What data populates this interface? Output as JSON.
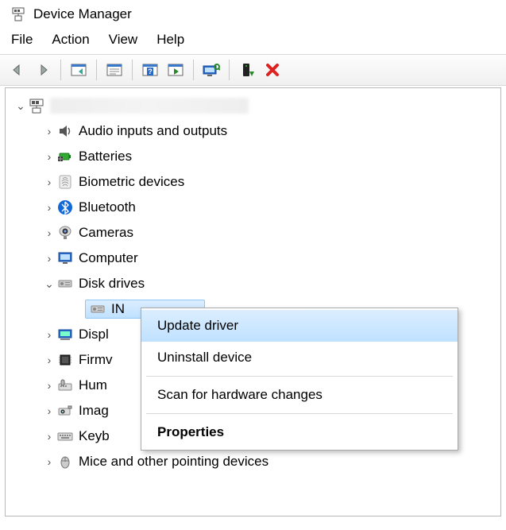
{
  "window": {
    "title": "Device Manager"
  },
  "menubar": {
    "file": "File",
    "action": "Action",
    "view": "View",
    "help": "Help"
  },
  "toolbar": {
    "back": "back-icon",
    "forward": "forward-icon",
    "show_hidden": "show-hidden-icon",
    "properties": "properties-icon",
    "help": "help-icon",
    "refresh": "refresh-icon",
    "scan": "scan-icon",
    "add": "add-device-icon",
    "remove": "remove-icon"
  },
  "tree": {
    "root_label": "",
    "nodes": {
      "audio": "Audio inputs and outputs",
      "batteries": "Batteries",
      "biometric": "Biometric devices",
      "bluetooth": "Bluetooth",
      "cameras": "Cameras",
      "computer": "Computer",
      "disk": "Disk drives",
      "disk_child": "IN",
      "display": "Displ",
      "firmware": "Firmv",
      "hid": "Hum",
      "imaging": "Imag",
      "keyboards": "Keyb",
      "mice": "Mice and other pointing devices"
    }
  },
  "context_menu": {
    "update_driver": "Update driver",
    "uninstall": "Uninstall device",
    "scan": "Scan for hardware changes",
    "properties": "Properties"
  }
}
